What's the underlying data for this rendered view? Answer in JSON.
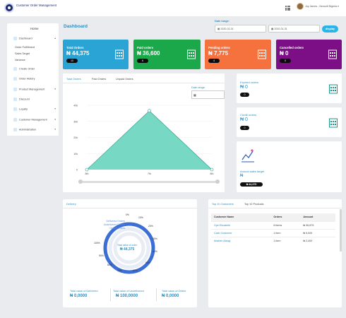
{
  "header": {
    "brand": "Customer Order Management",
    "user": "Joy James - Neosoft Nigeria",
    "user_suffix": "▾"
  },
  "sidebar": {
    "home": "Home",
    "items": [
      {
        "label": "Dashboard",
        "icon": "chart-icon",
        "chevron": "▴"
      },
      {
        "label": "Order Fulfillment"
      },
      {
        "label": "Sales Target"
      },
      {
        "label": "Variance"
      },
      {
        "label": "Create Order",
        "icon": "create-icon"
      },
      {
        "label": "Order History",
        "icon": "history-icon"
      },
      {
        "label": "Product Management",
        "icon": "product-icon",
        "chevron": "▾"
      },
      {
        "label": "Discount",
        "icon": "discount-icon"
      },
      {
        "label": "Loyalty",
        "icon": "loyalty-icon",
        "chevron": "▾"
      },
      {
        "label": "Customer Management",
        "icon": "customer-icon",
        "chevron": "▾"
      },
      {
        "label": "Administration",
        "icon": "admin-icon",
        "chevron": "▾"
      }
    ]
  },
  "page": {
    "title": "Dashboard",
    "date_range_label": "Date range:",
    "date_from": "2020-01-01",
    "date_to": "2020-01-31",
    "display_button": "display"
  },
  "cards": [
    {
      "label": "Total Orders",
      "value": "₦ 44,375",
      "count": "10",
      "color": "#2aa4d5"
    },
    {
      "label": "Paid orders",
      "value": "₦ 36,600",
      "count": "6",
      "color": "#1aa84a"
    },
    {
      "label": "Pending orders",
      "value": "₦ 7,775",
      "count": "4",
      "color": "#f5723f"
    },
    {
      "label": "Cancelled orders",
      "value": "₦ 0",
      "count": "0",
      "color": "#7d0f86"
    }
  ],
  "orders_panel": {
    "tabs": [
      "Total Orders",
      "Paid Orders",
      "Unpaid Orders"
    ],
    "date_range_label": "Date range:"
  },
  "chart_data": {
    "type": "area",
    "categories": [
      "8th",
      "7th",
      "8th"
    ],
    "values": [
      0,
      36600,
      0
    ],
    "yticks": [
      "40k",
      "30k",
      "20k",
      "10k",
      "0"
    ],
    "ylim": [
      0,
      40000
    ],
    "color": "#5fd1b8"
  },
  "side_cards": [
    {
      "label": "Expired orders",
      "value": "₦ 0",
      "count": "0"
    },
    {
      "label": "Credit orders",
      "value": "₦ 0",
      "count": "0"
    },
    {
      "label": "Annual sales target",
      "value": "₦",
      "count": "₦ 44,375"
    }
  ],
  "delivery": {
    "tab": "Delivery",
    "legend": [
      "Delivered Orders",
      "Undelivered Orders",
      "Online Orders"
    ],
    "center_label": "Total value of order",
    "center_value": "₦ 44,375",
    "pct_labels": [
      "0%",
      "10%",
      "20%",
      "30%",
      "40%",
      "50%",
      "60%",
      "70%",
      "80%",
      "90%",
      "100%"
    ],
    "summary": [
      {
        "label": "Total value of Delivered",
        "value": "₦ 0,0000"
      },
      {
        "label": "Total value of Undelivered",
        "value": "₦ 100,0000"
      },
      {
        "label": "Total value of Online",
        "value": "₦ 0,0000"
      }
    ]
  },
  "customers": {
    "tabs": [
      "Top 10 Customers",
      "Top 10 Products"
    ],
    "columns": [
      "Customer Name",
      "Orders",
      "Amount"
    ],
    "rows": [
      [
        "Oye Elizabeth",
        "8 items",
        "₦ 36,875"
      ],
      [
        "Cash Customer",
        "1 item",
        "₦ 5,000"
      ],
      [
        "Ibrahim Abiogi",
        "1 item",
        "₦ 2,400"
      ]
    ]
  }
}
